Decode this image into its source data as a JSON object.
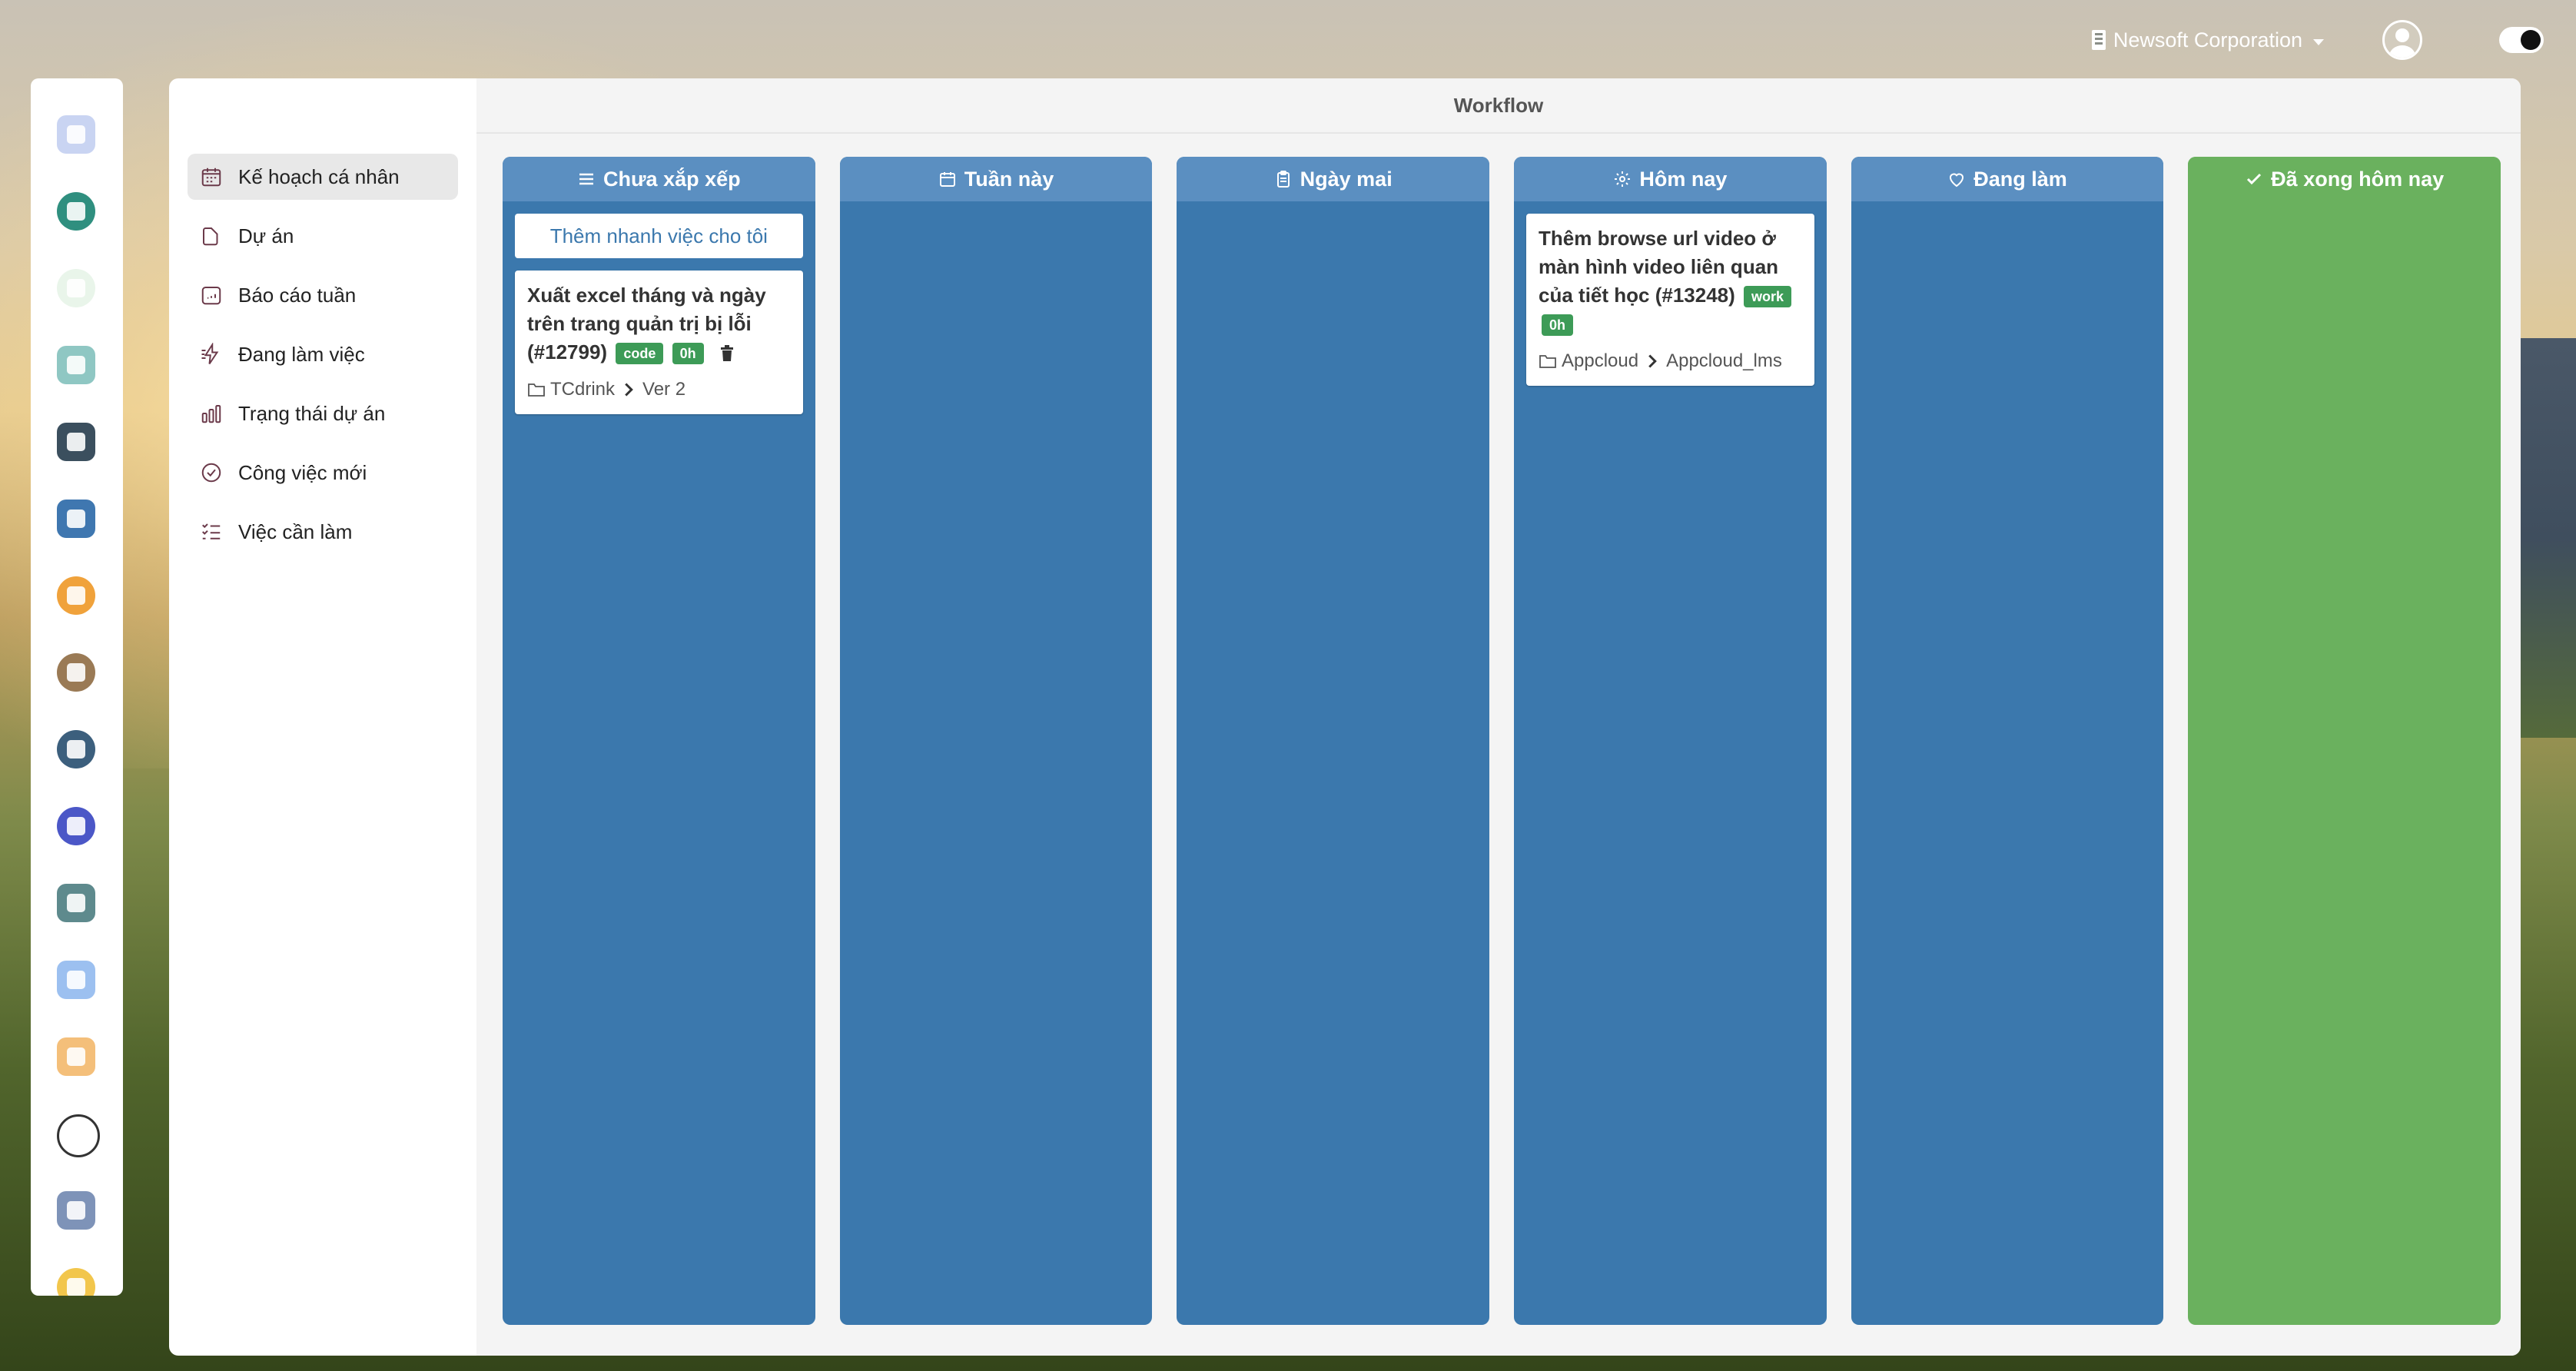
{
  "topbar": {
    "company": "Newsoft Corporation"
  },
  "rail": {
    "apps": [
      {
        "name": "planner-app-icon",
        "color": "#c9d4f2"
      },
      {
        "name": "calendar-24-app-icon",
        "color": "#2f8f7f"
      },
      {
        "name": "phone-app-icon",
        "color": "#e9f5ea"
      },
      {
        "name": "contacts-app-icon",
        "color": "#8fc7c3"
      },
      {
        "name": "camera-app-icon",
        "color": "#3b4f5e"
      },
      {
        "name": "documents-app-icon",
        "color": "#3f77b0"
      },
      {
        "name": "chat-app-icon",
        "color": "#f0a23b"
      },
      {
        "name": "wallet-app-icon",
        "color": "#9a7a55"
      },
      {
        "name": "dashboard-app-icon",
        "color": "#3c5f7d"
      },
      {
        "name": "tasks-app-icon",
        "color": "#4b57c7"
      },
      {
        "name": "store-app-icon",
        "color": "#5e8a8d"
      },
      {
        "name": "network-app-icon",
        "color": "#9cc0f0"
      },
      {
        "name": "crown-app-icon",
        "color": "#f4bf7a"
      },
      {
        "name": "timer-app-icon",
        "color": "#ffffff"
      },
      {
        "name": "team-app-icon",
        "color": "#7e93b8"
      },
      {
        "name": "iot-app-icon",
        "color": "#f2c64c"
      }
    ]
  },
  "nav": {
    "items": [
      {
        "label": "Kế hoạch cá nhân",
        "icon": "calendar-icon"
      },
      {
        "label": "Dự án",
        "icon": "folder-icon"
      },
      {
        "label": "Báo cáo tuần",
        "icon": "report-icon"
      },
      {
        "label": "Đang làm việc",
        "icon": "lightning-icon"
      },
      {
        "label": "Trạng thái dự án",
        "icon": "bar-chart-icon"
      },
      {
        "label": "Công việc mới",
        "icon": "check-circle-icon"
      },
      {
        "label": "Việc cần làm",
        "icon": "checklist-icon"
      }
    ]
  },
  "board": {
    "title": "Workflow",
    "columns": [
      {
        "title": "Chưa xắp xếp",
        "icon": "list-icon"
      },
      {
        "title": "Tuần này",
        "icon": "calendar-icon"
      },
      {
        "title": "Ngày mai",
        "icon": "clipboard-icon"
      },
      {
        "title": "Hôm nay",
        "icon": "gear-icon"
      },
      {
        "title": "Đang làm",
        "icon": "heart-icon"
      },
      {
        "title": "Đã xong hôm nay",
        "icon": "check-icon"
      }
    ],
    "quick_add": "Thêm nhanh việc cho tôi",
    "cards": [
      {
        "column": "Chưa xắp xếp",
        "title": "Xuất excel tháng và ngày trên trang quản trị bị lỗi (#12799)",
        "badges": [
          "code",
          "0h"
        ],
        "project": "TCdrink",
        "version": "Ver 2"
      },
      {
        "column": "Hôm nay",
        "title": "Thêm browse url video ở màn hình video liên quan của tiết học (#13248)",
        "badges": [
          "work",
          "0h"
        ],
        "project": "Appcloud",
        "version": "Appcloud_lms"
      }
    ]
  },
  "colors": {
    "column": "#3b78ad",
    "column_header": "#5b8fc1",
    "done": "#6ab15e",
    "badge": "#3d9b57"
  }
}
